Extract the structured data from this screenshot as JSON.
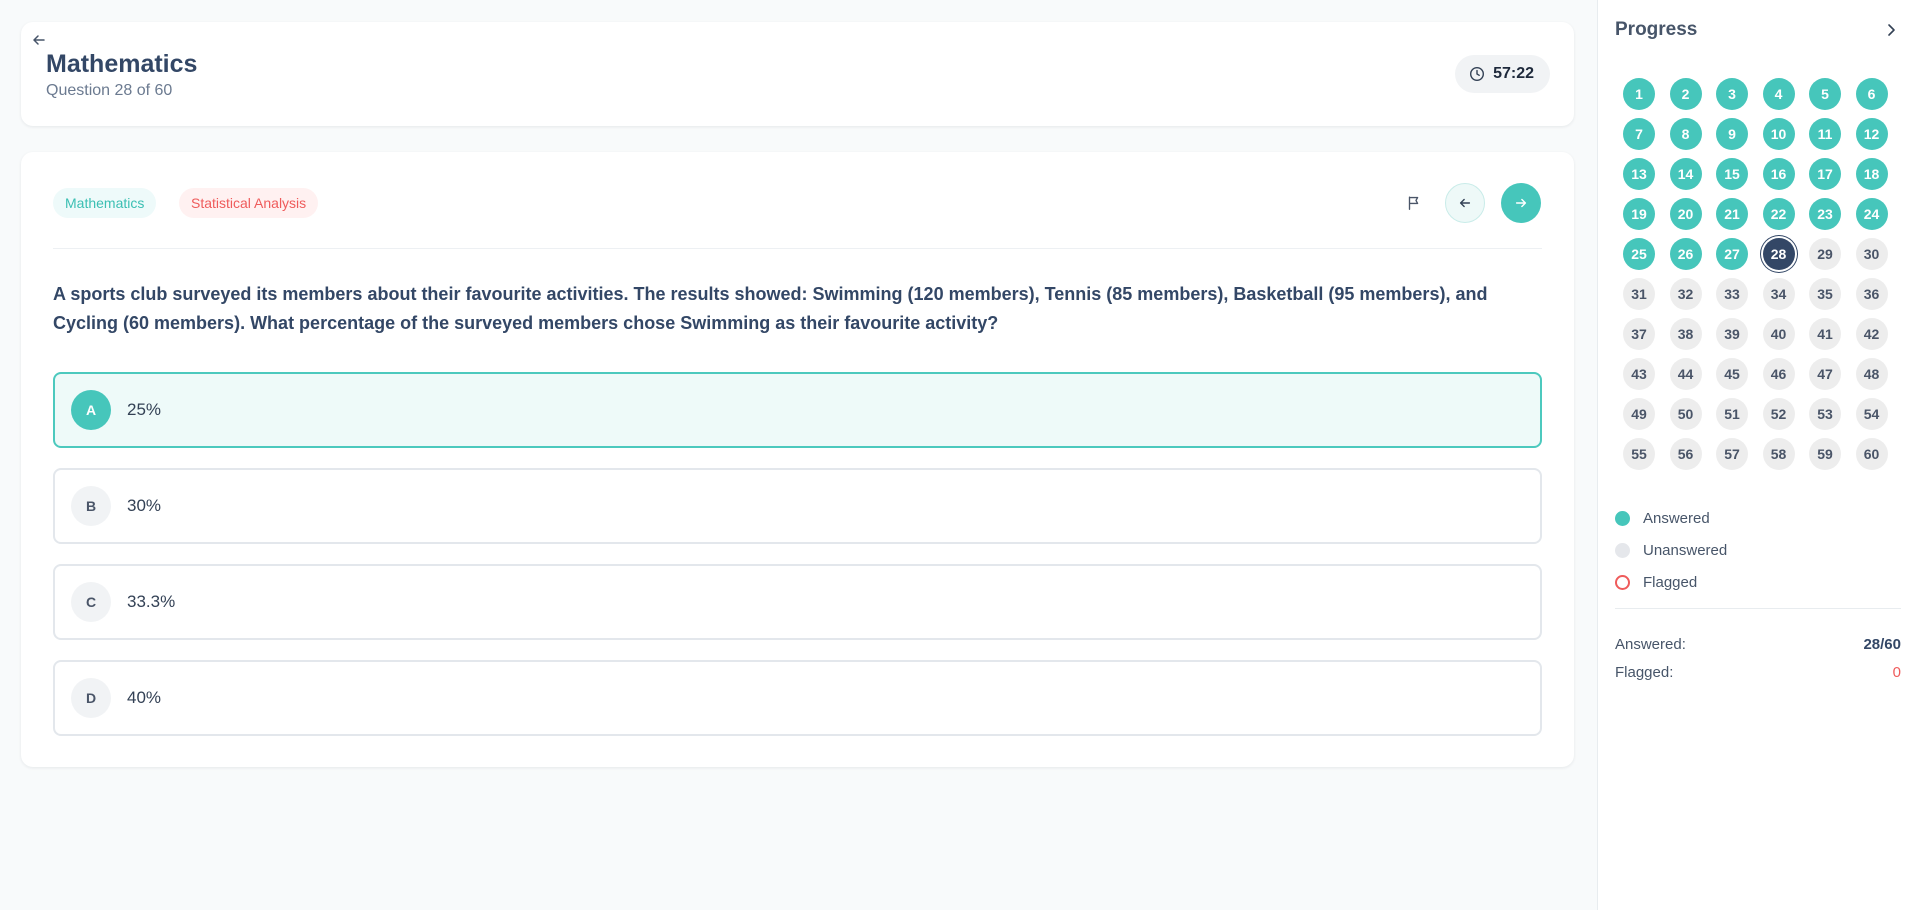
{
  "header": {
    "title": "Mathematics",
    "subtitle": "Question 28 of 60",
    "timer": "57:22"
  },
  "question": {
    "tags": [
      "Mathematics",
      "Statistical Analysis"
    ],
    "text": "A sports club surveyed its members about their favourite activities. The results showed: Swimming (120 members), Tennis (85 members), Basketball (95 members), and Cycling (60 members). What percentage of the surveyed members chose Swimming as their favourite activity?",
    "options": [
      {
        "letter": "A",
        "text": "25%",
        "selected": true
      },
      {
        "letter": "B",
        "text": "30%",
        "selected": false
      },
      {
        "letter": "C",
        "text": "33.3%",
        "selected": false
      },
      {
        "letter": "D",
        "text": "40%",
        "selected": false
      }
    ]
  },
  "sidebar": {
    "title": "Progress",
    "total_questions": 60,
    "answered_through": 27,
    "current": 28,
    "legend": {
      "answered": "Answered",
      "unanswered": "Unanswered",
      "flagged": "Flagged"
    },
    "stats": {
      "answered_label": "Answered:",
      "answered_value": "28/60",
      "flagged_label": "Flagged:",
      "flagged_value": "0"
    }
  },
  "colors": {
    "accent": "#46c6bb",
    "current": "#334766",
    "flag": "#ef5b5b"
  }
}
